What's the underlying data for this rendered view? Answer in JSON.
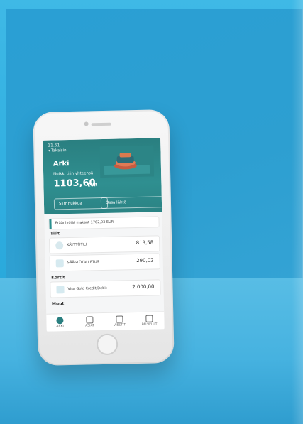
{
  "app": {
    "status_time": "11.51",
    "back_label": "◂ Takaisin",
    "hero": {
      "title": "Arki",
      "subtitle": "Nuikki tilin yhteensä",
      "amount": "1103,60",
      "currency": "EUR",
      "buttons": [
        "Siirr nukkua",
        "Ossa lähtö"
      ]
    },
    "banner": "Eräänlyöjät maksut 1762,93 EUR",
    "sections": {
      "accounts_title": "Tilit",
      "cards_title": "Kortit",
      "other_title": "Muut"
    },
    "accounts": [
      {
        "label": "KÄYTTÖTILI",
        "value": "813,58"
      },
      {
        "label": "SÄÄSTÖTALLETUS",
        "value": "290,02"
      }
    ],
    "cards": [
      {
        "label": "Visa Gold Credit/Debit",
        "value": "2 000,00"
      }
    ],
    "nav": [
      {
        "label": "ARKI"
      },
      {
        "label": "ASIAT"
      },
      {
        "label": "VIESTIT"
      },
      {
        "label": "PALVELUT"
      }
    ],
    "colors": {
      "background_blue": "#1fa3d6",
      "hero_teal": "#2a7f80"
    }
  }
}
